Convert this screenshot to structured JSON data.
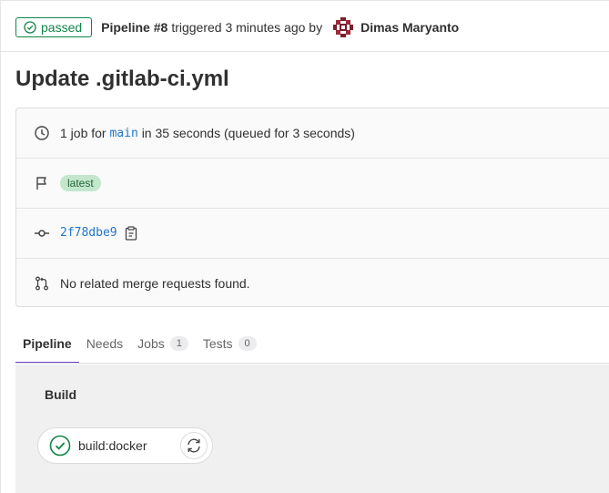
{
  "header": {
    "status": "passed",
    "pipeline_id": "Pipeline #8",
    "triggered_text": "triggered 3 minutes ago by",
    "author": "Dimas Maryanto"
  },
  "title": "Update .gitlab-ci.yml",
  "info": {
    "jobs_prefix": "1 job for",
    "branch": "main",
    "jobs_suffix": "in 35 seconds (queued for 3 seconds)",
    "tag": "latest",
    "commit_sha": "2f78dbe9",
    "merge_requests": "No related merge requests found."
  },
  "tabs": [
    {
      "label": "Pipeline"
    },
    {
      "label": "Needs"
    },
    {
      "label": "Jobs",
      "count": "1"
    },
    {
      "label": "Tests",
      "count": "0"
    }
  ],
  "graph": {
    "stage": "Build",
    "job": "build:docker"
  },
  "colors": {
    "success": "#108548",
    "link": "#1f75cb",
    "tab_active": "#6e49cb"
  }
}
